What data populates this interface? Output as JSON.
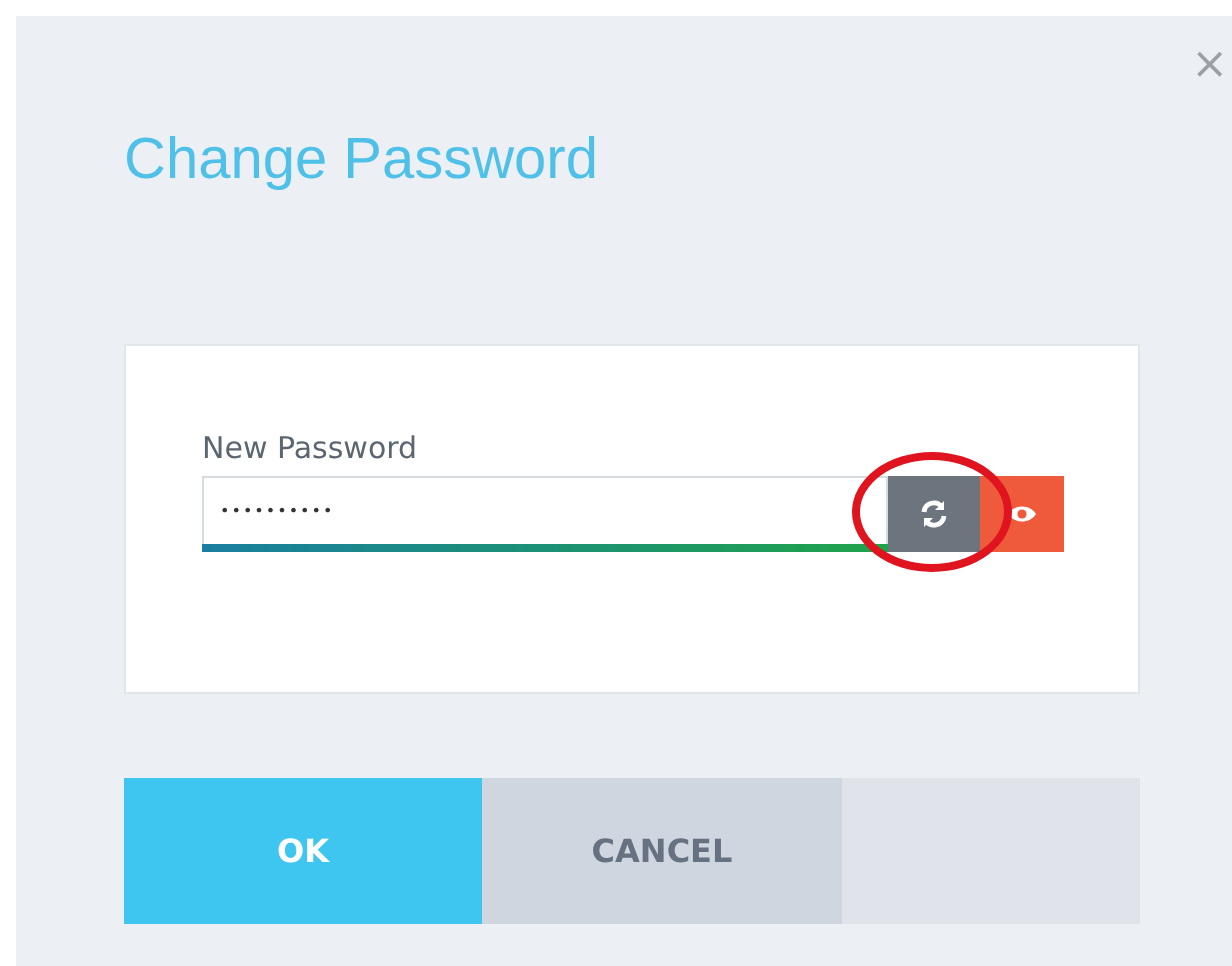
{
  "dialog": {
    "title": "Change Password",
    "close": "×"
  },
  "password_field": {
    "label": "New Password",
    "value": "••••••••••",
    "strength": {
      "level": 1.0
    },
    "highlighted": true
  },
  "buttons": [
    {
      "label": "OK",
      "kind": "primary"
    },
    {
      "label": "CANCEL",
      "kind": "secondary"
    },
    {
      "kind": "blank"
    }
  ]
}
